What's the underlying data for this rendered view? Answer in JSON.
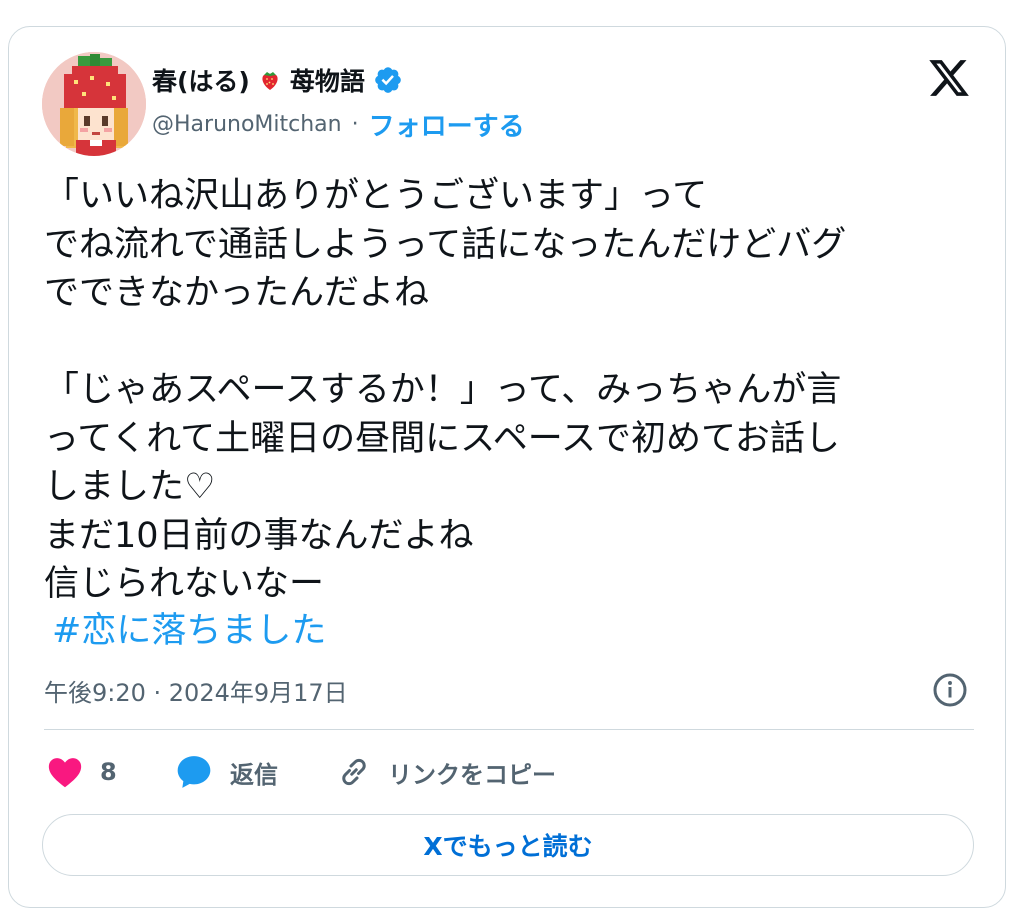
{
  "author": {
    "display_name": "春(はる)",
    "name_suffix": "苺物語",
    "handle": "@HarunoMitchan",
    "separator": "·",
    "follow_label": "フォローする",
    "verified": true
  },
  "tweet": {
    "text": "「いいね沢山ありがとうございます」って\nでね流れで通話しようって話になったんだけどバグ\nでできなかったんだよね\n\n「じゃあスペースするか！」って、みっちゃんが言\nってくれて土曜日の昼間にスペースで初めてお話し\nしました♡\nまだ10日前の事なんだよね\n信じられないなー",
    "hashtag": "#恋に落ちました",
    "timestamp": "午後9:20 · 2024年9月17日"
  },
  "actions": {
    "like_count": "8",
    "reply_label": "返信",
    "copy_link_label": "リンクをコピー"
  },
  "read_more_label": "Xでもっと読む",
  "colors": {
    "accent": "#1d9bf0",
    "like": "#f91880",
    "text": "#0f1419",
    "muted": "#536471",
    "border": "#cfd9de"
  },
  "icons": [
    "x-logo-icon",
    "verified-badge-icon",
    "strawberry-emoji-icon",
    "heart-icon",
    "reply-bubble-icon",
    "link-icon",
    "info-icon"
  ]
}
